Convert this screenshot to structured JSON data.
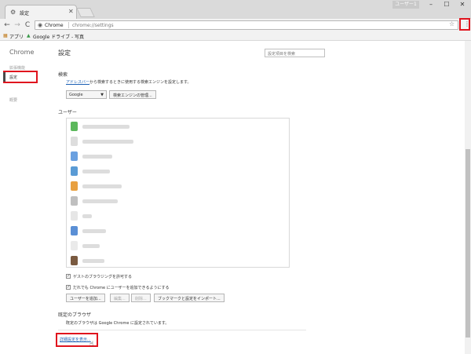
{
  "window": {
    "tab_title": "設定",
    "tab_close": "✕",
    "username": "ユーザー1",
    "minimize": "–",
    "maximize": "☐",
    "close": "✕"
  },
  "toolbar": {
    "back": "←",
    "forward": "→",
    "reload": "C",
    "origin": "Chrome",
    "url": "chrome://settings",
    "star": "☆",
    "menu": "⋮"
  },
  "bookmarks": {
    "apps": "アプリ",
    "item1": "Google ドライブ - 写真"
  },
  "sidebar": {
    "title": "Chrome",
    "items": [
      {
        "label": "拡張機能"
      },
      {
        "label": "設定"
      },
      {
        "label": "概要"
      }
    ]
  },
  "main": {
    "title": "設定",
    "search_placeholder": "設定項目を検索",
    "search_section": {
      "heading": "検索",
      "desc_link": "アドレスバー",
      "desc_rest": "から検索するときに使用する検索エンジンを設定します。",
      "engine_select": "Google",
      "manage_button": "検索エンジンの管理..."
    },
    "users_section": {
      "heading": "ユーザー",
      "users": [
        {
          "color": "#5cb85c"
        },
        {
          "color": "#dddddd"
        },
        {
          "color": "#6aa0e0"
        },
        {
          "color": "#5a9bd5"
        },
        {
          "color": "#e8a040"
        },
        {
          "color": "#bfbfbf"
        },
        {
          "color": "#e6e6e6"
        },
        {
          "color": "#5a8fd5"
        },
        {
          "color": "#eaeaea"
        },
        {
          "color": "#7a5a40"
        }
      ],
      "guest_check": "ゲストのブラウジングを許可する",
      "anyone_check": "だれでも Chrome にユーザーを追加できるようにする",
      "add_user": "ユーザーを追加...",
      "edit": "編集...",
      "delete": "削除...",
      "import": "ブックマークと設定をインポート..."
    },
    "default_browser": {
      "heading": "既定のブラウザ",
      "desc": "既定のブラウザは Google Chrome に設定されています。"
    },
    "advanced_link": "詳細設定を表示..."
  }
}
